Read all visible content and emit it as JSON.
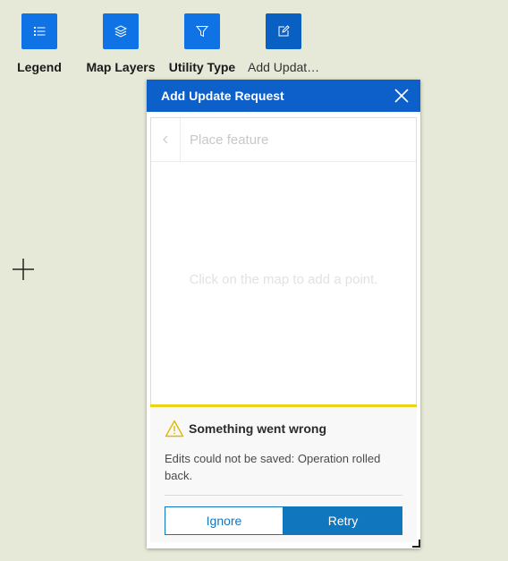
{
  "toolbar": {
    "widgets": [
      {
        "label": "Legend",
        "icon": "list-icon"
      },
      {
        "label": "Map Layers",
        "icon": "layers-icon"
      },
      {
        "label": "Utility Type",
        "icon": "filter-icon"
      },
      {
        "label": "Add Updat…",
        "icon": "edit-icon"
      }
    ]
  },
  "panel": {
    "title": "Add Update Request",
    "editor": {
      "title": "Place feature",
      "hint": "Click on the map to add a point."
    },
    "notice": {
      "title": "Something went wrong",
      "message": "Edits could not be saved: Operation rolled back.",
      "ignore_label": "Ignore",
      "retry_label": "Retry"
    }
  },
  "colors": {
    "map_background": "#e6e9d8",
    "widget_button": "#0f73e6",
    "panel_header": "#0d5fc9",
    "notice_border": "#edd317",
    "action_blue": "#1076be"
  }
}
